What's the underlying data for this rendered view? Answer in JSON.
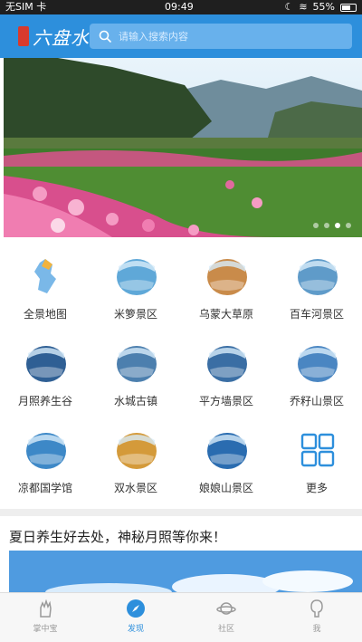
{
  "status_bar": {
    "carrier": "无SIM 卡",
    "time": "09:49",
    "battery": "55%"
  },
  "header": {
    "logo_text": "六盘水",
    "search_placeholder": "请输入搜索内容"
  },
  "banner": {
    "slide_count": 4,
    "active_slide": 3
  },
  "grid": {
    "items": [
      {
        "label": "全景地图",
        "icon": "map-icon",
        "color": "#7ab8e8"
      },
      {
        "label": "米箩景区",
        "icon": "scenic-thumb",
        "color": "#5fa8d8"
      },
      {
        "label": "乌蒙大草原",
        "icon": "scenic-thumb",
        "color": "#c98b4a"
      },
      {
        "label": "百车河景区",
        "icon": "scenic-thumb",
        "color": "#5f9bc9"
      },
      {
        "label": "月照养生谷",
        "icon": "scenic-thumb",
        "color": "#2f5f94"
      },
      {
        "label": "水城古镇",
        "icon": "scenic-thumb",
        "color": "#4c7fae"
      },
      {
        "label": "平方墙景区",
        "icon": "scenic-thumb",
        "color": "#3a6ea4"
      },
      {
        "label": "乔籽山景区",
        "icon": "scenic-thumb",
        "color": "#4a86c2"
      },
      {
        "label": "凉都国学馆",
        "icon": "scenic-thumb",
        "color": "#3d88c7"
      },
      {
        "label": "双水景区",
        "icon": "scenic-thumb",
        "color": "#d49a3a"
      },
      {
        "label": "娘娘山景区",
        "icon": "scenic-thumb",
        "color": "#2a6cb0"
      },
      {
        "label": "更多",
        "icon": "more-grid-icon",
        "color": "#2d8fdc"
      }
    ]
  },
  "article": {
    "title": "夏日养生好去处，神秘月照等你来！"
  },
  "tabbar": {
    "tabs": [
      {
        "label": "掌中宝",
        "icon": "hand-icon",
        "active": false
      },
      {
        "label": "发现",
        "icon": "compass-icon",
        "active": true
      },
      {
        "label": "社区",
        "icon": "planet-icon",
        "active": false
      },
      {
        "label": "我",
        "icon": "user-icon",
        "active": false
      }
    ]
  },
  "colors": {
    "primary": "#2d8fdc",
    "status_bar": "#1f1f1f"
  }
}
